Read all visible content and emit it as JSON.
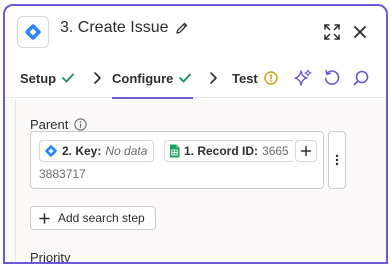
{
  "header": {
    "title": "3. Create Issue",
    "app_icon": "jira-diamond-icon",
    "edit_icon": "pencil-icon",
    "expand_icon": "expand-icon",
    "close_icon": "close-icon"
  },
  "tabs": [
    {
      "label": "Setup",
      "status": "check"
    },
    {
      "label": "Configure",
      "status": "check",
      "active": true
    },
    {
      "label": "Test",
      "status": "warning"
    }
  ],
  "toolbar": {
    "ai_icon": "sparkle-icon",
    "refresh_icon": "refresh-icon",
    "search_icon": "search-icon"
  },
  "parent_field": {
    "label": "Parent",
    "info_icon": "info-icon",
    "tokens": [
      {
        "label": "2. Key:",
        "value": "No data",
        "icon": "jira-diamond-icon"
      },
      {
        "label": "1. Record ID:",
        "value": "3665",
        "icon": "sheets-icon"
      }
    ],
    "wrapped_value": "3883717"
  },
  "add_search_step": {
    "label": "Add search step"
  },
  "priority_field": {
    "label": "Priority"
  },
  "colors": {
    "accent": "#6a5ad6",
    "success": "#1e8e5a",
    "warning": "#c9a21a",
    "jira_blue": "#2684ff",
    "sheets_green": "#1ea362"
  }
}
